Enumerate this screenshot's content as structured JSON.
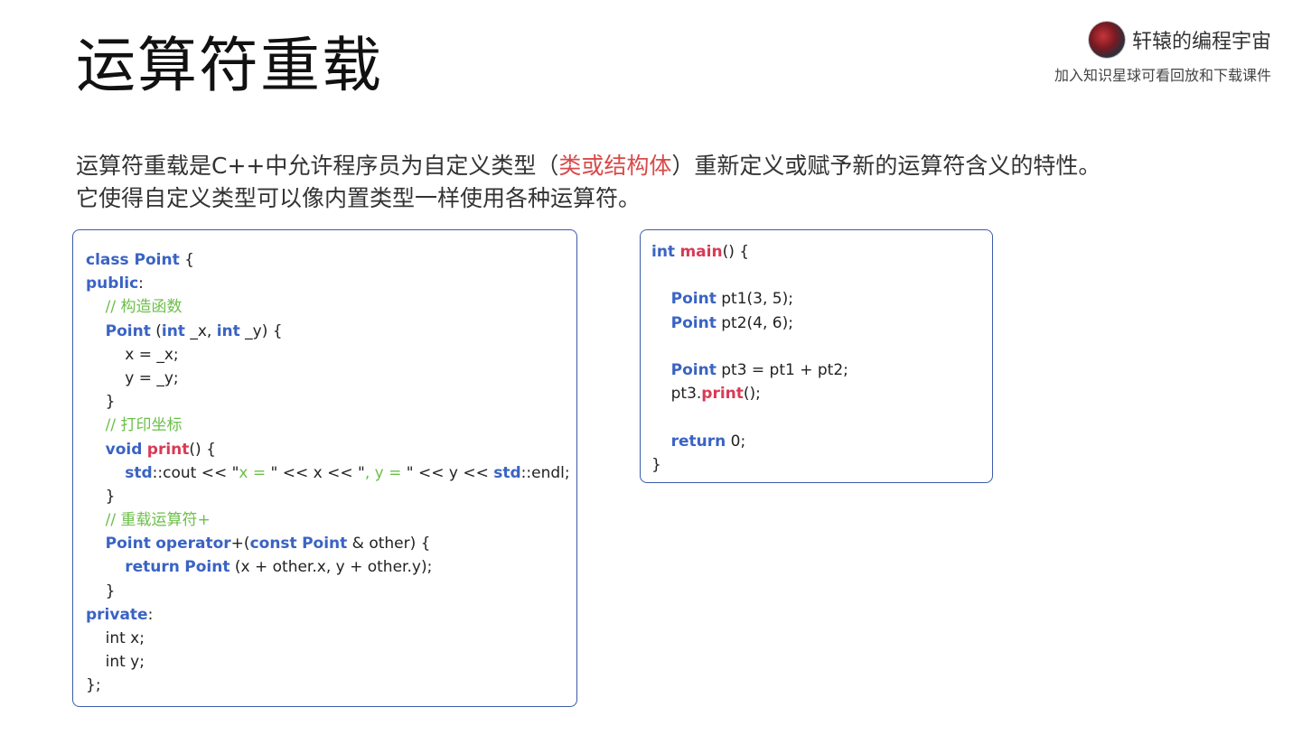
{
  "title": "运算符重载",
  "brand": {
    "name": "轩辕的编程宇宙",
    "subtitle": "加入知识星球可看回放和下载课件"
  },
  "description": {
    "line1_pre": "运算符重载是C++中允许程序员为自定义类型（",
    "line1_highlight": "类或结构体",
    "line1_post": "）重新定义或赋予新的运算符含义的特性。",
    "line2": "它使得自定义类型可以像内置类型一样使用各种运算符。"
  },
  "colors": {
    "keyword": "#3a63c4",
    "function": "#d93a55",
    "comment": "#6cbf4a",
    "highlight": "#d94a4a",
    "border": "#3b5ba9"
  },
  "code_left": [
    [
      {
        "t": "class ",
        "c": "kw"
      },
      {
        "t": "Point",
        "c": "kw"
      },
      {
        "t": " {"
      }
    ],
    [
      {
        "t": "public",
        "c": "kw"
      },
      {
        "t": ":"
      }
    ],
    [
      {
        "t": "    "
      },
      {
        "t": "// 构造函数",
        "c": "cm"
      }
    ],
    [
      {
        "t": "    "
      },
      {
        "t": "Point",
        "c": "kw"
      },
      {
        "t": " ("
      },
      {
        "t": "int",
        "c": "kw"
      },
      {
        "t": " _x, "
      },
      {
        "t": "int",
        "c": "kw"
      },
      {
        "t": " _y) {"
      }
    ],
    [
      {
        "t": "        x = _x;"
      }
    ],
    [
      {
        "t": "        y = _y;"
      }
    ],
    [
      {
        "t": "    }"
      }
    ],
    [
      {
        "t": "    "
      },
      {
        "t": "// 打印坐标",
        "c": "cm"
      }
    ],
    [
      {
        "t": "    "
      },
      {
        "t": "void",
        "c": "kw"
      },
      {
        "t": " "
      },
      {
        "t": "print",
        "c": "fn"
      },
      {
        "t": "() {"
      }
    ],
    [
      {
        "t": "        "
      },
      {
        "t": "std",
        "c": "kw"
      },
      {
        "t": "::cout << \""
      },
      {
        "t": "x = ",
        "c": "st"
      },
      {
        "t": "\" << x << \""
      },
      {
        "t": ", y = ",
        "c": "st"
      },
      {
        "t": "\" << y << "
      },
      {
        "t": "std",
        "c": "kw"
      },
      {
        "t": "::endl;"
      }
    ],
    [
      {
        "t": "    }"
      }
    ],
    [
      {
        "t": "    "
      },
      {
        "t": "// 重载运算符+",
        "c": "cm"
      }
    ],
    [
      {
        "t": "    "
      },
      {
        "t": "Point",
        "c": "kw"
      },
      {
        "t": " "
      },
      {
        "t": "operator",
        "c": "kw"
      },
      {
        "t": "+("
      },
      {
        "t": "const",
        "c": "kw"
      },
      {
        "t": " "
      },
      {
        "t": "Point",
        "c": "kw"
      },
      {
        "t": " & other) {"
      }
    ],
    [
      {
        "t": "        "
      },
      {
        "t": "return",
        "c": "kw"
      },
      {
        "t": " "
      },
      {
        "t": "Point",
        "c": "kw"
      },
      {
        "t": " (x + other.x, y + other.y);"
      }
    ],
    [
      {
        "t": "    }"
      }
    ],
    [
      {
        "t": "private",
        "c": "kw"
      },
      {
        "t": ":"
      }
    ],
    [
      {
        "t": "    int x;"
      }
    ],
    [
      {
        "t": "    int y;"
      }
    ],
    [
      {
        "t": "};"
      }
    ]
  ],
  "code_right": [
    [
      {
        "t": "int",
        "c": "kw"
      },
      {
        "t": " "
      },
      {
        "t": "main",
        "c": "fn"
      },
      {
        "t": "() {"
      }
    ],
    [
      {
        "t": ""
      }
    ],
    [
      {
        "t": "    "
      },
      {
        "t": "Point",
        "c": "kw"
      },
      {
        "t": " pt1(3, 5);"
      }
    ],
    [
      {
        "t": "    "
      },
      {
        "t": "Point",
        "c": "kw"
      },
      {
        "t": " pt2(4, 6);"
      }
    ],
    [
      {
        "t": ""
      }
    ],
    [
      {
        "t": "    "
      },
      {
        "t": "Point",
        "c": "kw"
      },
      {
        "t": " pt3 = pt1 + pt2;"
      }
    ],
    [
      {
        "t": "    pt3."
      },
      {
        "t": "print",
        "c": "fn"
      },
      {
        "t": "();"
      }
    ],
    [
      {
        "t": ""
      }
    ],
    [
      {
        "t": "    "
      },
      {
        "t": "return",
        "c": "kw"
      },
      {
        "t": " 0;"
      }
    ],
    [
      {
        "t": "}"
      }
    ]
  ]
}
